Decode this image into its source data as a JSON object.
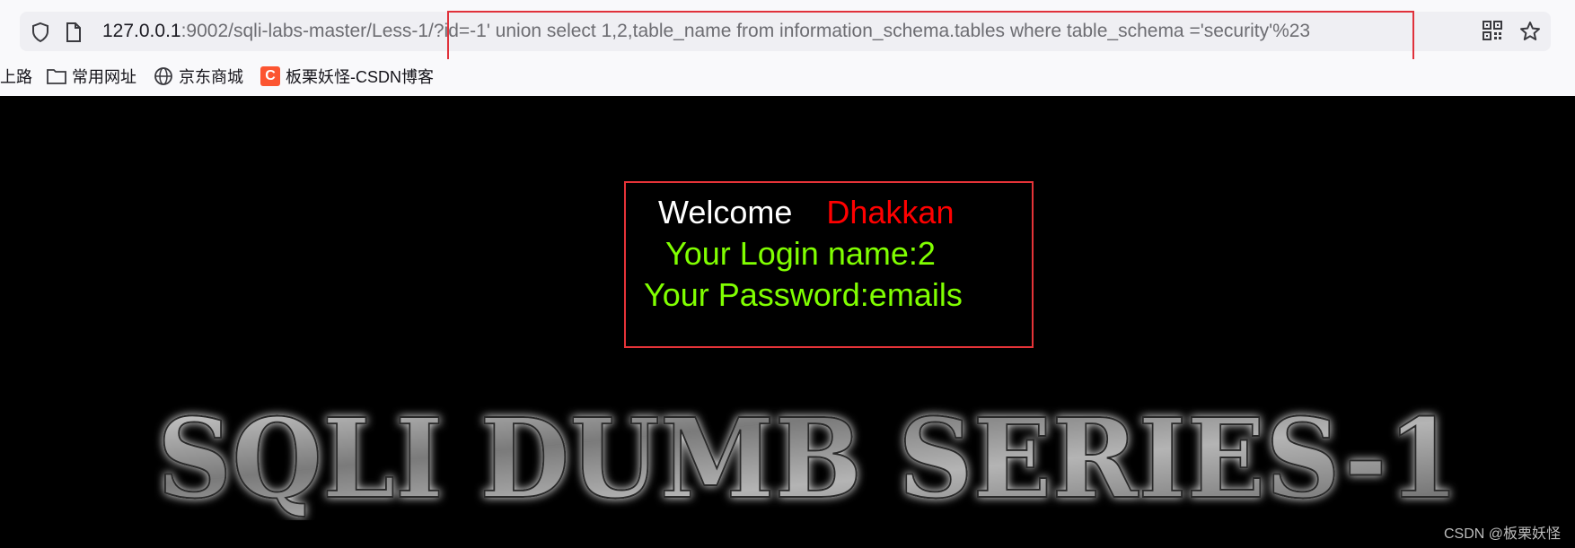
{
  "browser": {
    "url_host": "127.0.0.1",
    "url_rest": ":9002/sqli-labs-master/Less-1/?id=-1' union select 1,2,table_name from information_schema.tables where table_schema ='security'%23",
    "bookmarks": [
      {
        "label": "上路",
        "icon": "none"
      },
      {
        "label": "常用网址",
        "icon": "folder-icon"
      },
      {
        "label": "京东商城",
        "icon": "globe-icon"
      },
      {
        "label": "板栗妖怪-CSDN博客",
        "icon": "csdn-icon",
        "icon_text": "C"
      }
    ]
  },
  "result": {
    "welcome_word": "Welcome",
    "welcome_name": "Dhakkan",
    "login": "Your Login name:2",
    "password": "Your Password:emails"
  },
  "banner": {
    "text": "SQLI DUMB SERIES-1"
  },
  "watermark": "CSDN @板栗妖怪",
  "colors": {
    "accent_red": "#e53338",
    "name_red": "#ff0000",
    "green": "#80ff00",
    "background": "#000000"
  }
}
